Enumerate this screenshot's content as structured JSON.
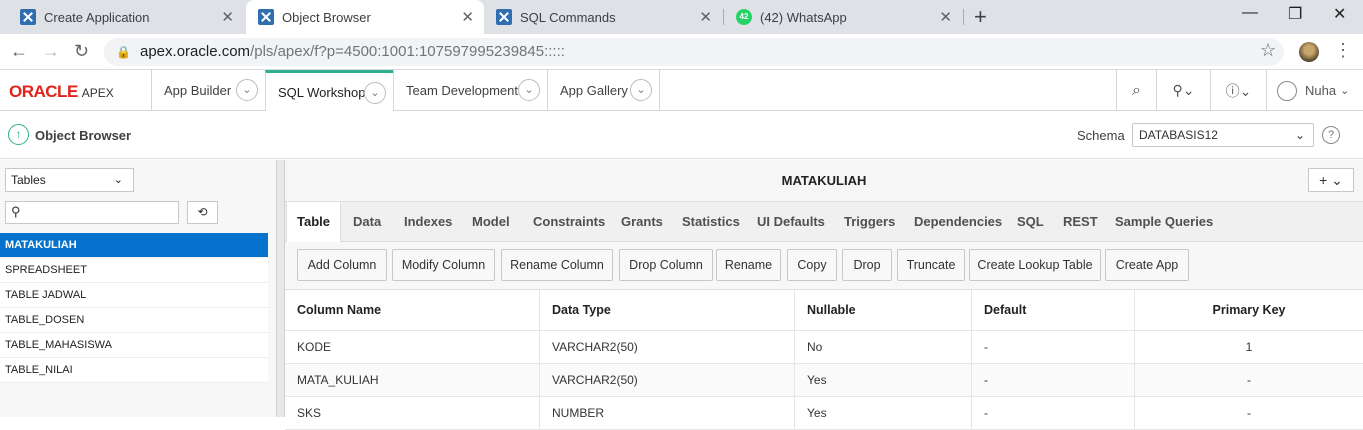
{
  "browser": {
    "tabs": [
      {
        "title": "Create Application",
        "icon": "apex-icon"
      },
      {
        "title": "Object Browser",
        "icon": "apex-icon"
      },
      {
        "title": "SQL Commands",
        "icon": "apex-icon"
      },
      {
        "title": "(42) WhatsApp",
        "icon": "whatsapp-icon",
        "badge": "42"
      }
    ],
    "url_host": "apex.oracle.com",
    "url_path": "/pls/apex/f?p=4500:1001:107597995239845:::::"
  },
  "apex": {
    "logo": "ORACLE",
    "logo_suffix": "APEX",
    "nav": [
      "App Builder",
      "SQL Workshop",
      "Team Development",
      "App Gallery"
    ],
    "user": "Nuha"
  },
  "page": {
    "title": "Object Browser",
    "schema_label": "Schema",
    "schema_value": "DATABASIS12"
  },
  "left": {
    "object_type": "Tables",
    "objects": [
      "MATAKULIAH",
      "SPREADSHEET",
      "TABLE JADWAL",
      "TABLE_DOSEN",
      "TABLE_MAHASISWA",
      "TABLE_NILAI"
    ]
  },
  "right": {
    "object_name": "MATAKULIAH",
    "tabs": [
      "Table",
      "Data",
      "Indexes",
      "Model",
      "Constraints",
      "Grants",
      "Statistics",
      "UI Defaults",
      "Triggers",
      "Dependencies",
      "SQL",
      "REST",
      "Sample Queries"
    ],
    "buttons": [
      "Add Column",
      "Modify Column",
      "Rename Column",
      "Drop Column",
      "Rename",
      "Copy",
      "Drop",
      "Truncate",
      "Create Lookup Table",
      "Create App"
    ],
    "columns": [
      "Column Name",
      "Data Type",
      "Nullable",
      "Default",
      "Primary Key"
    ],
    "rows": [
      [
        "KODE",
        "VARCHAR2(50)",
        "No",
        "-",
        "1"
      ],
      [
        "MATA_KULIAH",
        "VARCHAR2(50)",
        "Yes",
        "-",
        "-"
      ],
      [
        "SKS",
        "NUMBER",
        "Yes",
        "-",
        "-"
      ]
    ]
  },
  "colors": {
    "accent": "#2eaf8f",
    "selected": "#0572ce",
    "oracle_red": "#e2231a"
  }
}
